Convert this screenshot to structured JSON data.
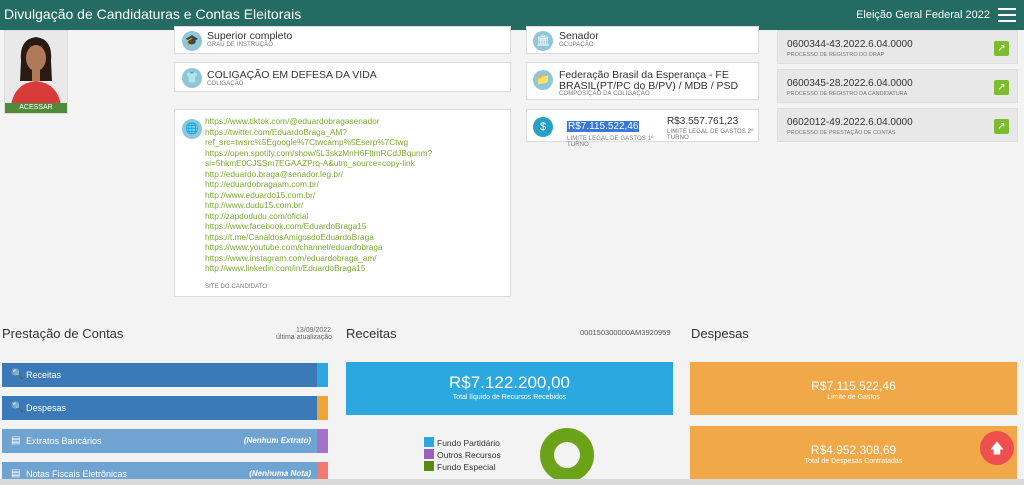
{
  "header": {
    "title": "Divulgação de Candidaturas e Contas Eleitorais",
    "election": "Eleição Geral Federal 2022"
  },
  "photo": {
    "caption": "ACESSAR"
  },
  "cards": {
    "education": {
      "value": "Superior completo",
      "label": "GRAU DE INSTRUÇÃO"
    },
    "occupation": {
      "value": "Senador",
      "label": "OCUPAÇÃO"
    },
    "coalition": {
      "value": "COLIGAÇÃO EM DEFESA DA VIDA",
      "label": "COLIGAÇÃO"
    },
    "composition": {
      "value_line1": "Federação Brasil da Esperança - FE",
      "value_line2": "BRASIL(PT/PC do B/PV) / MDB / PSD",
      "label": "COMPOSIÇÃO DA COLIGAÇÃO"
    },
    "spending_limit": {
      "first_value": "R$7.115.522,46",
      "first_label_line1": "LIMITE LEGAL DE GASTOS 1º",
      "first_label_line2": "TURNO",
      "second_value": "R$3.557.761,23",
      "second_label_line1": "LIMITE LEGAL DE GASTOS 2º",
      "second_label_line2": "TURNO"
    },
    "site": {
      "label": "SITE DO CANDIDATO",
      "links": [
        "https://www.tiktok.com/@eduardobragasenador",
        "https://twitter.com/EduardoBraga_AM?",
        "ref_src=twsrc%5Egoogle%7Ctwcamp%5Eserp%7Ctwg",
        "https://open.spotify.com/show/5L3skzMnH6FltmRCdJBqunm?",
        "si=5hkmE0CJSSm7EGAAZPrq-A&utm_source=copy-link",
        "http://eduardo.braga@senador.leg.br/",
        "http://eduardobragaam.com.br/",
        "http://www.eduardo15.com.br/",
        "http://www.dudu15.com.br/",
        "http://zapdodudu.com/oficial",
        "https://www.facebook.com/EduardoBraga15",
        "https://t.me/CanaldosAmigosdoEduardoBraga",
        "https://www.youtube.com/channel/eduardobraga",
        "https://www.instagram.com/eduardobraga_am/",
        "http://www.linkedin.com/in/EduardoBraga15"
      ]
    }
  },
  "processes": [
    {
      "number": "0600344-43.2022.6.04.0000",
      "label": "PROCESSO DE REGISTRO DO DRAP"
    },
    {
      "number": "0600345-28.2022.6.04.0000",
      "label": "PROCESSO DE REGISTRO DA CANDIDATURA"
    },
    {
      "number": "0602012-49.2022.6.04.0000",
      "label": "PROCESSO DE PRESTAÇÃO DE CONTAS"
    }
  ],
  "accounts": {
    "title": "Prestação de Contas",
    "date": "13/09/2022",
    "date_label": "última atualização",
    "items": [
      {
        "label": "Receitas",
        "note": "",
        "color": "#3b7ab8",
        "tab": "#2aa8df"
      },
      {
        "label": "Despesas",
        "note": "",
        "color": "#3b7ab8",
        "tab": "#f0a33a"
      },
      {
        "label": "Extratos Bancários",
        "note": "(Nenhum Extrato)",
        "color": "#6fa4d2",
        "tab": "#a472c9"
      },
      {
        "label": "Notas Fiscais Eletrônicas",
        "note": "(Nenhuma Nota)",
        "color": "#6fa4d2",
        "tab": "#f07a72"
      }
    ]
  },
  "receitas": {
    "title": "Receitas",
    "code": "000150300000AM3920959",
    "total": "R$7.122.200,00",
    "total_label": "Total líquido de Recursos Recebidos",
    "legend": [
      {
        "name": "Fundo Partidário",
        "color": "#2aa8df"
      },
      {
        "name": "Outros Recursos",
        "color": "#9b5fc0"
      },
      {
        "name": "Fundo Especial",
        "color": "#5a8a10"
      }
    ]
  },
  "despesas": {
    "title": "Despesas",
    "limit": "R$7.115.522,46",
    "limit_label": "Limite de Gastos",
    "contracted": "R$4.952.308,69",
    "contracted_label": "Total de Despesas Contratadas"
  }
}
